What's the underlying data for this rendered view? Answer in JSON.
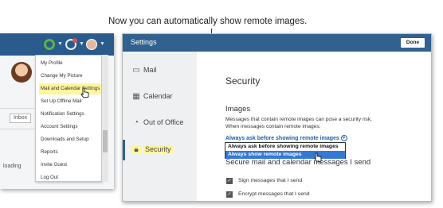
{
  "caption": "Now you can automatically show remote images.",
  "left_panel": {
    "inbox_label": "Inbox",
    "loading_label": "loading",
    "menu": [
      "My Profile",
      "Change My Picture",
      "Mail and Calendar Settings",
      "Set Up Offline Mail",
      "Notification Settings",
      "Account Settings",
      "Downloads and Setup",
      "Reports",
      "Invite Guest",
      "Log Out"
    ],
    "highlighted_menu_item": "Mail and Calendar Settings"
  },
  "settings": {
    "title": "Settings",
    "done_label": "Done",
    "nav": [
      {
        "label": "Mail",
        "icon": "mail-icon"
      },
      {
        "label": "Calendar",
        "icon": "calendar-icon"
      },
      {
        "label": "Out of Office",
        "icon": "out-of-office-icon"
      },
      {
        "label": "Security",
        "icon": "lock-icon"
      }
    ],
    "active_nav": "Security",
    "section_title": "Security",
    "images_heading": "Images",
    "images_desc_1": "Messages that contain remote images can pose a security risk.",
    "images_desc_2": "When messages contain remote images:",
    "select_value": "Always ask before showing remote images",
    "options": [
      "Always ask before showing remote images",
      "Always show remote images"
    ],
    "selected_option": "Always show remote images",
    "secure_heading": "Secure mail and calendar messages I send",
    "checkboxes": [
      {
        "label": "Sign messages that I send",
        "checked": true
      },
      {
        "label": "Encrypt messages that I send",
        "checked": true
      }
    ]
  },
  "colors": {
    "header_blue": "#31618f",
    "highlight_yellow": "#fff59b",
    "link_blue": "#1f5fa8",
    "option_selected": "#3478d4"
  }
}
